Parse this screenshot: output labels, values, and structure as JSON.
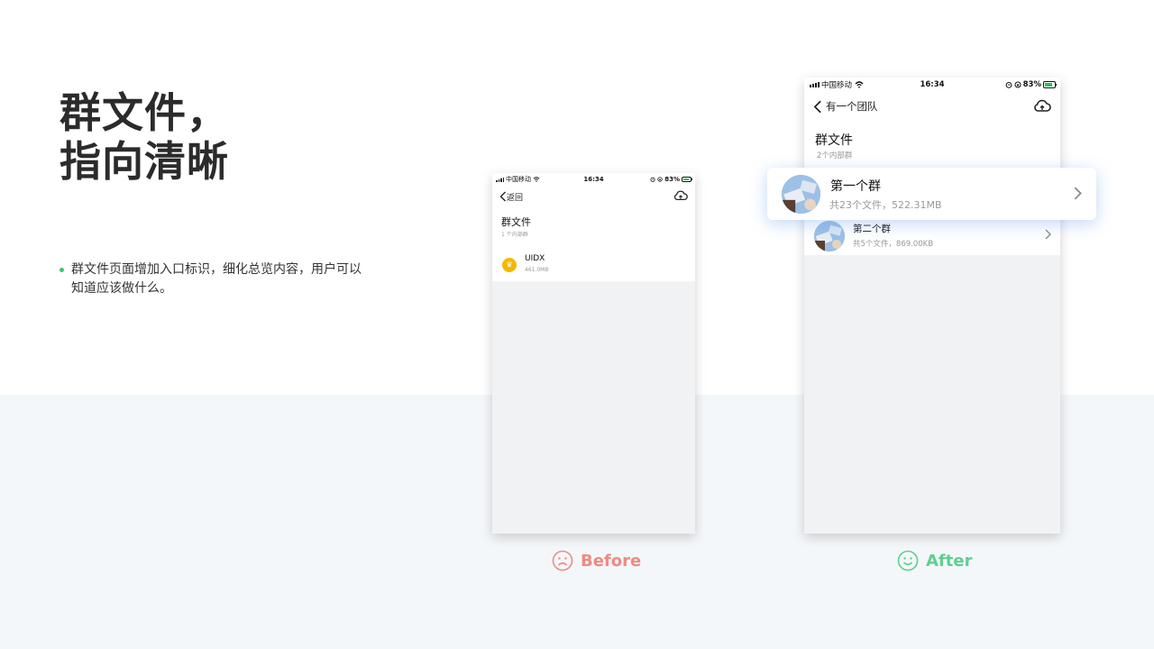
{
  "headline": {
    "line1": "群文件，",
    "line2": "指向清晰"
  },
  "bullet": {
    "text": "群文件页面增加入口标识，细化总览内容，用户可以知道应该做什么。"
  },
  "before_phone": {
    "status": {
      "carrier": "中国移动",
      "time": "16:34",
      "battery": "83%"
    },
    "nav": {
      "back_label": "返回"
    },
    "title": "群文件",
    "subtitle": "1 个内部群",
    "items": [
      {
        "name": "UIDX",
        "size": "461.0MB"
      }
    ]
  },
  "after_phone": {
    "status": {
      "carrier": "中国移动",
      "time": "16:34",
      "battery": "83%"
    },
    "nav": {
      "back_label": "有一个团队"
    },
    "title": "群文件",
    "subtitle": "2个内部群",
    "items": [
      {
        "name": "第一个群",
        "meta": "共23个文件，522.31MB"
      },
      {
        "name": "第二个群",
        "meta": "共5个文件，869.00KB"
      }
    ]
  },
  "labels": {
    "before": "Before",
    "after": "After"
  },
  "colors": {
    "accent_green": "#3cc37a",
    "before_red": "#f08a82",
    "after_green": "#5fcf8d",
    "band": "#f4f7fa"
  },
  "icons": [
    "back-chevron-icon",
    "cloud-upload-icon",
    "wifi-icon",
    "alarm-icon",
    "battery-icon",
    "sad-face-icon",
    "smile-face-icon",
    "chevron-right-icon"
  ]
}
